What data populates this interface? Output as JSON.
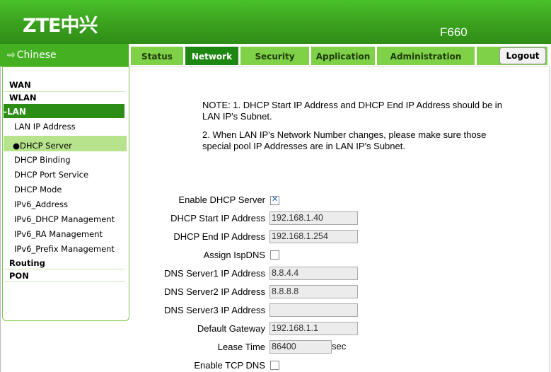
{
  "header": {
    "logo": "ZTE中兴",
    "model": "F660"
  },
  "language_link": "Chinese",
  "tabs": [
    "Status",
    "Network",
    "Security",
    "Application",
    "Administration"
  ],
  "active_tab": "Network",
  "logout_label": "Logout",
  "sidebar": {
    "wan": "WAN",
    "wlan": "WLAN",
    "lan": "-LAN",
    "lan_items": [
      "LAN IP Address",
      "DHCP Server",
      "DHCP Binding",
      "DHCP Port Service",
      "DHCP Mode",
      "IPv6_Address",
      "IPv6_DHCP Management",
      "IPv6_RA Management",
      "IPv6_Prefix Management"
    ],
    "active_item": "DHCP Server",
    "routing": "Routing",
    "pon": "PON"
  },
  "note": {
    "line1": "NOTE:  1. DHCP Start IP Address and DHCP End IP Address should be in LAN IP's Subnet.",
    "line2": "2. When LAN IP's Network Number changes, please make sure those special pool IP Addresses are in LAN IP's Subnet."
  },
  "form": {
    "enable_dhcp_label": "Enable DHCP Server",
    "enable_dhcp_checked": true,
    "start_ip_label": "DHCP Start IP Address",
    "start_ip": "192.168.1.40",
    "end_ip_label": "DHCP End IP Address",
    "end_ip": "192.168.1.254",
    "assign_isp_dns_label": "Assign IspDNS",
    "assign_isp_dns_checked": false,
    "dns1_label": "DNS Server1 IP Address",
    "dns1": "8.8.4.4",
    "dns2_label": "DNS Server2 IP Address",
    "dns2": "8.8.8.8",
    "dns3_label": "DNS Server3 IP Address",
    "dns3": "",
    "gateway_label": "Default Gateway",
    "gateway": "192.168.1.1",
    "lease_label": "Lease Time",
    "lease": "86400",
    "lease_unit": "sec",
    "tcp_dns_label": "Enable TCP DNS",
    "tcp_dns_checked": false
  },
  "colors": {
    "header_green": "#3aa01d",
    "tab_active": "#1e8711",
    "tab_inactive": "#7fd147",
    "menu_active": "#b7e38c"
  }
}
